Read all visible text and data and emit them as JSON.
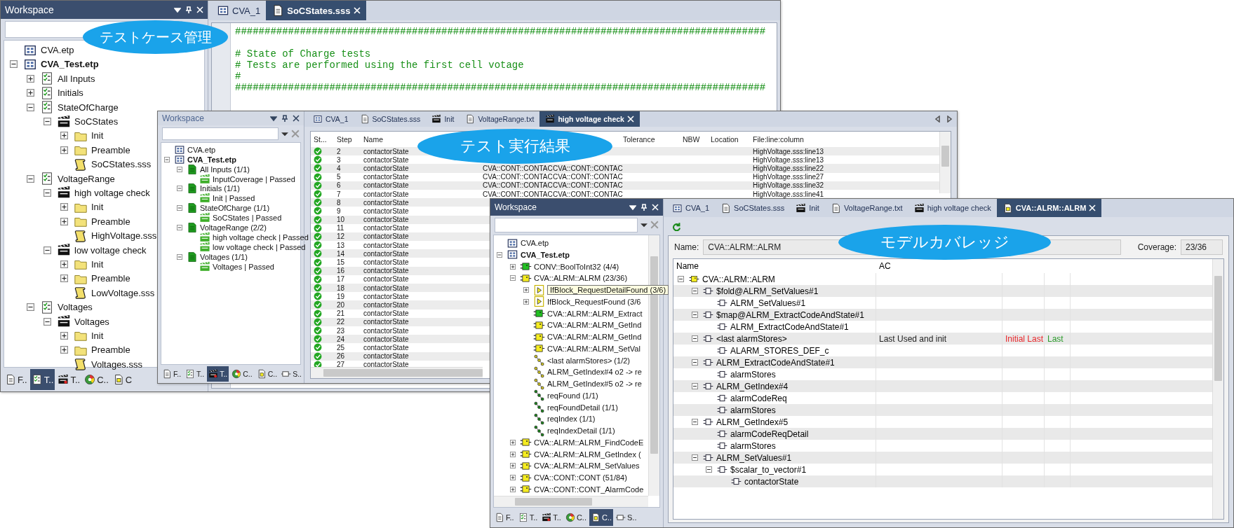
{
  "windows": [
    {
      "kind": "editor",
      "workspace": {
        "title": "Workspace",
        "active": true,
        "tree": [
          {
            "label": "CVA.etp",
            "kind": "project",
            "active": false
          },
          {
            "label": "CVA_Test.etp",
            "kind": "project",
            "active": true,
            "expanded": true,
            "children": [
              {
                "label": "All Inputs",
                "kind": "suite",
                "expanded": false
              },
              {
                "label": "Initials",
                "kind": "suite",
                "expanded": false
              },
              {
                "label": "StateOfCharge",
                "kind": "suite",
                "expanded": true,
                "children": [
                  {
                    "label": "SoCStates",
                    "kind": "testcase",
                    "expanded": true,
                    "children": [
                      {
                        "label": "Init",
                        "kind": "folder",
                        "expanded": false
                      },
                      {
                        "label": "Preamble",
                        "kind": "folder",
                        "expanded": false
                      },
                      {
                        "label": "SoCStates.sss",
                        "kind": "script"
                      }
                    ]
                  }
                ]
              },
              {
                "label": "VoltageRange",
                "kind": "suite",
                "expanded": true,
                "children": [
                  {
                    "label": "high voltage check",
                    "kind": "testcase",
                    "expanded": true,
                    "children": [
                      {
                        "label": "Init",
                        "kind": "folder",
                        "expanded": false
                      },
                      {
                        "label": "Preamble",
                        "kind": "folder",
                        "expanded": false
                      },
                      {
                        "label": "HighVoltage.sss",
                        "kind": "script"
                      }
                    ]
                  },
                  {
                    "label": "low voltage check",
                    "kind": "testcase",
                    "expanded": true,
                    "children": [
                      {
                        "label": "Init",
                        "kind": "folder",
                        "expanded": false
                      },
                      {
                        "label": "Preamble",
                        "kind": "folder",
                        "expanded": false
                      },
                      {
                        "label": "LowVoltage.sss",
                        "kind": "script"
                      }
                    ]
                  }
                ]
              },
              {
                "label": "Voltages",
                "kind": "suite",
                "expanded": true,
                "children": [
                  {
                    "label": "Voltages",
                    "kind": "testcase",
                    "expanded": true,
                    "children": [
                      {
                        "label": "Init",
                        "kind": "folder",
                        "expanded": false
                      },
                      {
                        "label": "Preamble",
                        "kind": "folder",
                        "expanded": false
                      },
                      {
                        "label": "Voltages.sss",
                        "kind": "script"
                      }
                    ]
                  }
                ]
              }
            ]
          }
        ],
        "bottom_tabs": [
          {
            "label": "F..",
            "selected": false
          },
          {
            "label": "T..",
            "selected": true
          },
          {
            "label": "T..",
            "selected": false
          },
          {
            "label": "C..",
            "selected": false
          },
          {
            "label": "C",
            "selected": false
          }
        ]
      },
      "tabs": [
        {
          "label": "CVA_1",
          "selected": false
        },
        {
          "label": "SoCStates.sss",
          "selected": true
        }
      ],
      "code": [
        {
          "kind": "comment",
          "text": "##########################################################################################"
        },
        {
          "kind": "blank"
        },
        {
          "kind": "comment",
          "text": "# State of Charge tests"
        },
        {
          "kind": "comment",
          "text": "# Tests are performed using the first cell votage"
        },
        {
          "kind": "comment",
          "text": "#"
        },
        {
          "kind": "comment",
          "text": "##########################################################################################"
        }
      ]
    },
    {
      "kind": "results",
      "workspace": {
        "title": "Workspace",
        "active": false,
        "tree": [
          {
            "label": "CVA.etp",
            "kind": "project",
            "active": false
          },
          {
            "label": "CVA_Test.etp",
            "kind": "project",
            "active": true,
            "expanded": true,
            "children": [
              {
                "label": "All Inputs (1/1)",
                "kind": "group_passed",
                "expanded": true,
                "children": [
                  {
                    "label": "InputCoverage | Passed",
                    "kind": "case_passed"
                  }
                ]
              },
              {
                "label": "Initials (1/1)",
                "kind": "group_passed",
                "expanded": true,
                "children": [
                  {
                    "label": "Init | Passed",
                    "kind": "case_passed"
                  }
                ]
              },
              {
                "label": "StateOfCharge (1/1)",
                "kind": "group_passed",
                "expanded": true,
                "children": [
                  {
                    "label": "SoCStates | Passed",
                    "kind": "case_passed"
                  }
                ]
              },
              {
                "label": "VoltageRange (2/2)",
                "kind": "group_passed",
                "expanded": true,
                "children": [
                  {
                    "label": "high voltage check | Passed",
                    "kind": "case_passed"
                  },
                  {
                    "label": "low voltage check | Passed",
                    "kind": "case_passed"
                  }
                ]
              },
              {
                "label": "Voltages (1/1)",
                "kind": "group_passed",
                "expanded": true,
                "children": [
                  {
                    "label": "Voltages | Passed",
                    "kind": "case_passed"
                  }
                ]
              }
            ]
          }
        ],
        "bottom_tabs": [
          {
            "label": "F..",
            "selected": false
          },
          {
            "label": "T..",
            "selected": false
          },
          {
            "label": "T..",
            "selected": true
          },
          {
            "label": "C..",
            "selected": false
          },
          {
            "label": "C..",
            "selected": false
          },
          {
            "label": "S..",
            "selected": false
          }
        ]
      },
      "tabs": [
        {
          "label": "CVA_1",
          "selected": false
        },
        {
          "label": "SoCStates.sss",
          "selected": false
        },
        {
          "label": "Init",
          "selected": false
        },
        {
          "label": "VoltageRange.txt",
          "selected": false
        },
        {
          "label": "high voltage check",
          "selected": true
        }
      ],
      "table": {
        "columns": [
          "St...",
          "Step",
          "Name",
          "Tolerance",
          "NBW",
          "Location",
          "File:line:column"
        ],
        "rows": [
          {
            "kind": "passed",
            "step": "2",
            "name": "contactorState",
            "file": "HighVoltage.sss:line13"
          },
          {
            "kind": "passed",
            "step": "3",
            "name": "contactorState",
            "file": "HighVoltage.sss:line13"
          },
          {
            "kind": "passed",
            "step": "4",
            "name": "contactorState",
            "column_4": "CVA::CONT::CONTAC",
            "column_5": "CVA::CONT::CONTAC",
            "file": "HighVoltage.sss:line22"
          },
          {
            "kind": "passed",
            "step": "5",
            "name": "contactorState",
            "column_4": "CVA::CONT::CONTAC",
            "column_5": "CVA::CONT::CONTAC",
            "file": "HighVoltage.sss:line27"
          },
          {
            "kind": "passed",
            "step": "6",
            "name": "contactorState",
            "column_4": "CVA::CONT::CONTAC",
            "column_5": "CVA::CONT::CONTAC",
            "file": "HighVoltage.sss:line32"
          },
          {
            "kind": "passed",
            "step": "7",
            "name": "contactorState",
            "column_4": "CVA::CONT::CONTAC",
            "column_5": "CVA::CONT::CONTAC",
            "file": "HighVoltage.sss:line41"
          },
          {
            "kind": "passed",
            "step": "8",
            "name": "contactorState"
          },
          {
            "kind": "passed",
            "step": "9",
            "name": "contactorState"
          },
          {
            "kind": "passed",
            "step": "10",
            "name": "contactorState"
          },
          {
            "kind": "passed",
            "step": "11",
            "name": "contactorState"
          },
          {
            "kind": "passed",
            "step": "12",
            "name": "contactorState"
          },
          {
            "kind": "passed",
            "step": "13",
            "name": "contactorState"
          },
          {
            "kind": "passed",
            "step": "14",
            "name": "contactorState"
          },
          {
            "kind": "passed",
            "step": "15",
            "name": "contactorState"
          },
          {
            "kind": "passed",
            "step": "16",
            "name": "contactorState"
          },
          {
            "kind": "passed",
            "step": "17",
            "name": "contactorState"
          },
          {
            "kind": "passed",
            "step": "18",
            "name": "contactorState"
          },
          {
            "kind": "passed",
            "step": "19",
            "name": "contactorState"
          },
          {
            "kind": "passed",
            "step": "20",
            "name": "contactorState"
          },
          {
            "kind": "passed",
            "step": "21",
            "name": "contactorState"
          },
          {
            "kind": "passed",
            "step": "22",
            "name": "contactorState"
          },
          {
            "kind": "passed",
            "step": "23",
            "name": "contactorState"
          },
          {
            "kind": "passed",
            "step": "24",
            "name": "contactorState"
          },
          {
            "kind": "passed",
            "step": "25",
            "name": "contactorState"
          },
          {
            "kind": "passed",
            "step": "26",
            "name": "contactorState"
          },
          {
            "kind": "passed",
            "step": "27",
            "name": "contactorState"
          }
        ]
      }
    },
    {
      "kind": "coverage",
      "workspace": {
        "title": "Workspace",
        "active": true,
        "tree": [
          {
            "label": "CVA.etp",
            "kind": "project",
            "active": false
          },
          {
            "label": "CVA_Test.etp",
            "kind": "project",
            "active": true,
            "expanded": true,
            "children": [
              {
                "label": "CONV::BoolToInt32 (4/4)",
                "kind": "block_green",
                "expanded": false
              },
              {
                "label": "CVA::ALRM::ALRM (23/36)",
                "kind": "block_yellow",
                "expanded": true,
                "children": [
                  {
                    "label": "IfBlock_RequestDetailFound (3/6)",
                    "kind": "ifblock",
                    "expanded": false,
                    "tooltip": true
                  },
                  {
                    "label": "IfBlock_RequestFound (3/6",
                    "kind": "ifblock",
                    "expanded": false,
                    "tooltip": false
                  },
                  {
                    "label": "CVA::ALRM::ALRM_Extract",
                    "kind": "block_green"
                  },
                  {
                    "label": "CVA::ALRM::ALRM_GetInd",
                    "kind": "block_yellow"
                  },
                  {
                    "label": "CVA::ALRM::ALRM_GetInd",
                    "kind": "block_yellow"
                  },
                  {
                    "label": "CVA::ALRM::ALRM_SetVal",
                    "kind": "block_yellow"
                  },
                  {
                    "label": "<last alarmStores> (1/2)",
                    "kind": "signal_yellow"
                  },
                  {
                    "label": "ALRM_GetIndex#4 o2 -> re",
                    "kind": "signal_yellow"
                  },
                  {
                    "label": "ALRM_GetIndex#5 o2 -> re",
                    "kind": "signal_yellow"
                  },
                  {
                    "label": "reqFound (1/1)",
                    "kind": "signal_green"
                  },
                  {
                    "label": "reqFoundDetail (1/1)",
                    "kind": "signal_green"
                  },
                  {
                    "label": "reqIndex (1/1)",
                    "kind": "signal_green"
                  },
                  {
                    "label": "reqIndexDetail (1/1)",
                    "kind": "signal_green"
                  }
                ]
              },
              {
                "label": "CVA::ALRM::ALRM_FindCodeE",
                "kind": "block_yellow",
                "expanded": false
              },
              {
                "label": "CVA::ALRM::ALRM_GetIndex (",
                "kind": "block_yellow",
                "expanded": false
              },
              {
                "label": "CVA::ALRM::ALRM_SetValues",
                "kind": "block_yellow",
                "expanded": false
              },
              {
                "label": "CVA::CONT::CONT (51/84)",
                "kind": "block_yellow",
                "expanded": false
              },
              {
                "label": "CVA::CONT::CONT_AlarmCode",
                "kind": "block_yellow",
                "expanded": false
              }
            ]
          }
        ],
        "bottom_tabs": [
          {
            "label": "F..",
            "selected": false
          },
          {
            "label": "T..",
            "selected": false
          },
          {
            "label": "T..",
            "selected": false
          },
          {
            "label": "C..",
            "selected": false
          },
          {
            "label": "C..",
            "selected": true
          },
          {
            "label": "S..",
            "selected": false
          }
        ]
      },
      "tabs": [
        {
          "label": "CVA_1",
          "selected": false
        },
        {
          "label": "SoCStates.sss",
          "selected": false
        },
        {
          "label": "Init",
          "selected": false
        },
        {
          "label": "VoltageRange.txt",
          "selected": false
        },
        {
          "label": "high voltage check",
          "selected": false
        },
        {
          "label": "CVA::ALRM::ALRM",
          "selected": true
        }
      ],
      "name_label": "Name:",
      "name_value": "CVA::ALRM::ALRM",
      "coverage_label": "Coverage:",
      "coverage_value": "23/36",
      "table": {
        "columns": [
          "Name",
          "AC"
        ],
        "rows": [
          {
            "name": "CVA::ALRM::ALRM",
            "kind": "block_yellow",
            "expanded": true,
            "children": [
              {
                "name": "$fold@ALRM_SetValues#1",
                "kind": "port",
                "expanded": true,
                "children": [
                  {
                    "name": "ALRM_SetValues#1",
                    "kind": "port"
                  }
                ]
              },
              {
                "name": "$map@ALRM_ExtractCodeAndState#1",
                "kind": "port",
                "expanded": true,
                "children": [
                  {
                    "name": "ALRM_ExtractCodeAndState#1",
                    "kind": "port"
                  }
                ]
              },
              {
                "name": "<last alarmStores>",
                "kind": "port",
                "expanded": true,
                "ac": "Last Used and init",
                "column_3": "Initial Last",
                "column_4": "Last",
                "children": [
                  {
                    "name": "ALARM_STORES_DEF_c",
                    "kind": "port"
                  }
                ]
              },
              {
                "name": "ALRM_ExtractCodeAndState#1",
                "kind": "port",
                "expanded": true,
                "children": [
                  {
                    "name": "alarmStores",
                    "kind": "port"
                  }
                ]
              },
              {
                "name": "ALRM_GetIndex#4",
                "kind": "port",
                "expanded": true,
                "children": [
                  {
                    "name": "alarmCodeReq",
                    "kind": "port"
                  },
                  {
                    "name": "alarmStores",
                    "kind": "port"
                  }
                ]
              },
              {
                "name": "ALRM_GetIndex#5",
                "kind": "port",
                "expanded": true,
                "children": [
                  {
                    "name": "alarmCodeReqDetail",
                    "kind": "port"
                  },
                  {
                    "name": "alarmStores",
                    "kind": "port"
                  }
                ]
              },
              {
                "name": "ALRM_SetValues#1",
                "kind": "port",
                "expanded": true,
                "children": [
                  {
                    "name": "$scalar_to_vector#1",
                    "kind": "port",
                    "expanded": true,
                    "children": [
                      {
                        "name": "contactorState",
                        "kind": "port"
                      }
                    ]
                  }
                ]
              }
            ]
          }
        ]
      }
    }
  ],
  "callouts": [
    "テストケース管理",
    "テスト実行結果",
    "モデルカバレッジ"
  ]
}
